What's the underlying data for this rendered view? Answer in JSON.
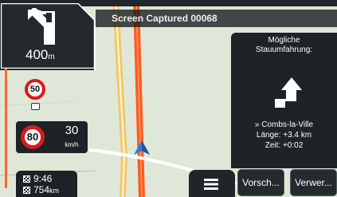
{
  "titlebar": {
    "title": "Screen Captured 00068"
  },
  "turn": {
    "icon": "turn-left-arrow",
    "distance_value": "400",
    "distance_unit": "m"
  },
  "speed_limits": {
    "small_limit": "50",
    "current_limit": "80",
    "current_speed": "30",
    "speed_unit": "km/h"
  },
  "trip": {
    "arrival_time": "9:46",
    "remaining_distance": "754",
    "remaining_distance_unit": "km"
  },
  "detour_panel": {
    "title_line1": "Mögliche",
    "title_line2": "Stauumfahrung:",
    "destination": "» Combs-la-Ville",
    "length": "Länge: +3.4 km",
    "time": "Zeit: +0:02",
    "icon": "detour-arrow"
  },
  "buttons": {
    "propose": "Vorsch...",
    "reject": "Verwer..."
  },
  "menu": {
    "icon": "hamburger-menu"
  },
  "colors": {
    "route_orange": "#ff5a1f",
    "road_yellow": "#f2c86b",
    "map_background": "#dfe8d8",
    "panel_dark": "#1d2326",
    "limit_red": "#d61b1b",
    "position_blue": "#2c78d8"
  }
}
